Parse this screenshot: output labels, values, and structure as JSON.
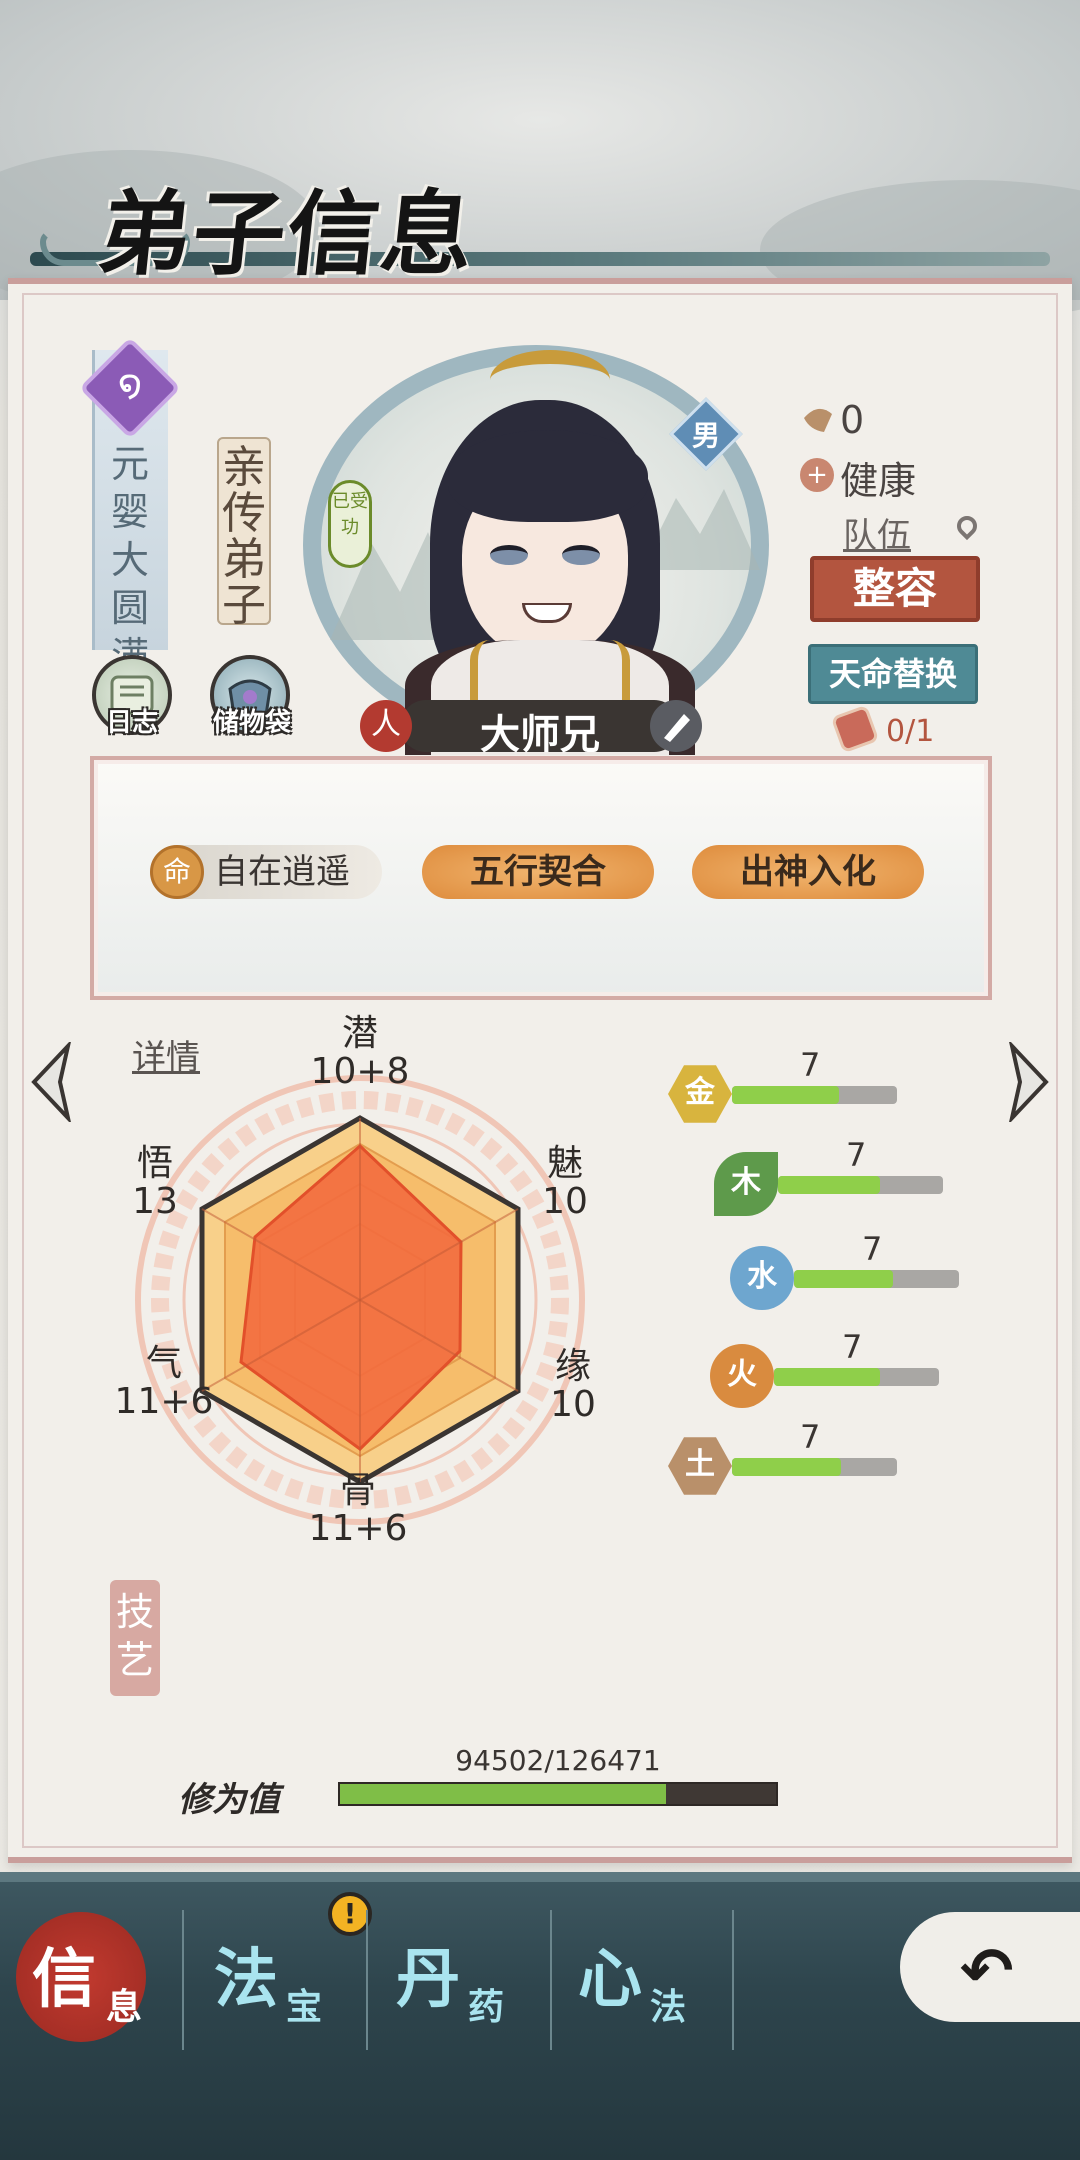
{
  "header": {
    "title": "弟子信息"
  },
  "disciple": {
    "realm": "元婴大圆满",
    "rank": "亲传弟子",
    "gender": "男",
    "seal": "已受功",
    "name": "大师兄",
    "name_left_badge": "人",
    "name_right_badge": "",
    "karma": "0",
    "health": "健康",
    "team": "队伍",
    "makeover_label": "整容",
    "fate_label": "天命替换",
    "fate_count": "0/1"
  },
  "quick_buttons": [
    {
      "label": "日志",
      "icon": "scroll-icon"
    },
    {
      "label": "储物袋",
      "icon": "bag-icon"
    }
  ],
  "traits": {
    "own_icon": "命",
    "own": "自在逍遥",
    "others": [
      "五行契合",
      "出神入化"
    ]
  },
  "attributes": {
    "detail_link": "详情",
    "potential": {
      "name": "潜",
      "value": "10+8"
    },
    "charm": {
      "name": "魅",
      "value": "10"
    },
    "fate": {
      "name": "缘",
      "value": "10"
    },
    "bone": {
      "name": "骨",
      "value": "11+6"
    },
    "qi": {
      "name": "气",
      "value": "11+6"
    },
    "insight": {
      "name": "悟",
      "value": "13"
    }
  },
  "elements": [
    {
      "name": "金",
      "value": "7",
      "level": 0.65,
      "color": "#d8b43e"
    },
    {
      "name": "木",
      "value": "7",
      "level": 0.62,
      "color": "#5e9a4b"
    },
    {
      "name": "水",
      "value": "7",
      "level": 0.6,
      "color": "#6ea6cf"
    },
    {
      "name": "火",
      "value": "7",
      "level": 0.64,
      "color": "#d98b3f"
    },
    {
      "name": "土",
      "value": "7",
      "level": 0.66,
      "color": "#b9906a"
    }
  ],
  "skills_tag": "技艺",
  "cultivation": {
    "label": "修为值",
    "current": 94502,
    "max": 126471,
    "text": "94502/126471"
  },
  "bottom_nav": {
    "tabs": [
      {
        "main": "信",
        "sub": "息",
        "active": true
      },
      {
        "main": "法",
        "sub": "宝",
        "active": false
      },
      {
        "main": "丹",
        "sub": "药",
        "active": false
      },
      {
        "main": "心",
        "sub": "法",
        "active": false
      }
    ],
    "alert": "!",
    "back": "↶"
  }
}
